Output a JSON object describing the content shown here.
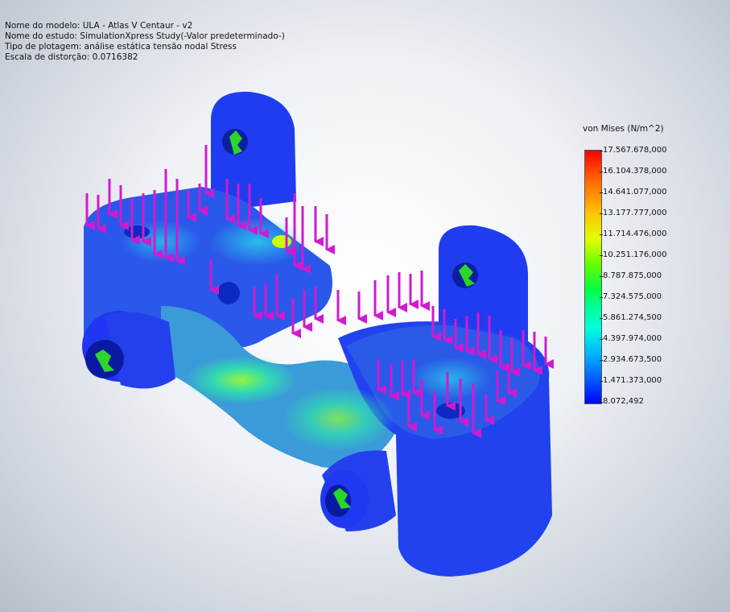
{
  "header": {
    "model_name": "Nome do modelo: ULA - Atlas V Centaur - v2",
    "study_name": "Nome do estudo: SimulationXpress Study(-Valor predeterminado-)",
    "plot_type": "Tipo de plotagem: análise estática tensão nodal Stress",
    "distortion_scale": "Escala de distorção: 0.0716382"
  },
  "legend": {
    "title": "von Mises (N/m^2)",
    "ticks": [
      "17.567.678,000",
      "16.104.378,000",
      "14.641.077,000",
      "13.177.777,000",
      "11.714.476,000",
      "10.251.176,000",
      "8.787.875,000",
      "7.324.575,000",
      "5.861.274,500",
      "4.397.974,000",
      "2.934.673,500",
      "1.471.373,000",
      "8.072,492"
    ],
    "max_color": "#ff0000",
    "min_color": "#0000ff"
  },
  "colors": {
    "load_arrow": "#d01ad0",
    "part_base": "#1a3ef0",
    "fixture": "#2bd62b"
  }
}
